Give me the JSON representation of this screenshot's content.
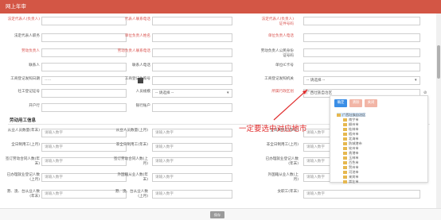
{
  "window": {
    "title": "网上年审"
  },
  "form_rows": [
    [
      {
        "label": "法定代表人(负责人)",
        "required": true,
        "value": "",
        "placeholder": ""
      },
      {
        "label": "代表人联系电话",
        "required": true,
        "value": "",
        "placeholder": ""
      },
      {
        "label": "法定代表人(负责人)证件号码",
        "required": true,
        "value": "",
        "placeholder": ""
      }
    ],
    [
      {
        "label": "法定代表人职务",
        "required": false,
        "value": "",
        "placeholder": ""
      },
      {
        "label": "单位负责人姓名",
        "required": true,
        "value": "",
        "placeholder": ""
      },
      {
        "label": "单位负责人电话",
        "required": true,
        "value": "",
        "placeholder": ""
      }
    ],
    [
      {
        "label": "劳动负责人",
        "required": true,
        "value": "",
        "placeholder": ""
      },
      {
        "label": "劳动负责人联系电话",
        "required": true,
        "value": "",
        "placeholder": ""
      },
      {
        "label": "劳动负责人公民身份证号码",
        "required": false,
        "value": "",
        "placeholder": ""
      }
    ],
    [
      {
        "label": "联系人",
        "required": false,
        "value": "",
        "placeholder": ""
      },
      {
        "label": "联系人电话",
        "required": false,
        "value": "",
        "placeholder": ""
      },
      {
        "label": "单位IC卡号",
        "required": false,
        "value": "",
        "placeholder": ""
      }
    ],
    [
      {
        "label": "工商登记发照日期",
        "required": false,
        "value": "-----",
        "placeholder": ""
      },
      {
        "label": "工商登记执照号",
        "required": false,
        "value": "",
        "placeholder": ""
      },
      {
        "label": "工商登记发照机关",
        "required": false,
        "value": "-- 请选择 --",
        "placeholder": ""
      }
    ],
    [
      {
        "label": "社工登记证号",
        "required": false,
        "value": "",
        "placeholder": ""
      },
      {
        "label": "人员规模",
        "required": false,
        "value": "-- 请选择 --",
        "placeholder": ""
      },
      {
        "label": "所属行政区划",
        "required": true,
        "value": "广西壮族自治区",
        "placeholder": ""
      }
    ],
    [
      {
        "label": "开户行",
        "required": false,
        "value": "",
        "placeholder": ""
      },
      {
        "label": "银行账户",
        "required": false,
        "value": "",
        "placeholder": ""
      },
      {
        "label": "",
        "required": false,
        "value": "",
        "placeholder": ""
      }
    ]
  ],
  "section": {
    "title": "劳动用工信息"
  },
  "labor_rows": [
    [
      {
        "label": "从业人员数量(年末)",
        "placeholder": "请输入数字"
      },
      {
        "label": "从业人员数量(上月)",
        "placeholder": "请输入数字"
      },
      {
        "label": "全日制用工(年末)",
        "placeholder": "请输入数字"
      }
    ],
    [
      {
        "label": "全日制用工(上月)",
        "placeholder": "请输入数字"
      },
      {
        "label": "非全日制用工(年末)",
        "placeholder": "请输入数字"
      },
      {
        "label": "非全日制用工(上月)",
        "placeholder": "请输入数字"
      }
    ],
    [
      {
        "label": "签订劳动合同人数(年末)",
        "placeholder": "请输入数字"
      },
      {
        "label": "签订劳动合同人数(上月)",
        "placeholder": "请输入数字"
      },
      {
        "label": "已办理就业登记人数(年末)",
        "placeholder": "请输入数字"
      }
    ],
    [
      {
        "label": "已办理就业登记人数(上月)",
        "placeholder": "请输入数字"
      },
      {
        "label": "外国籍从业人数(年末)",
        "placeholder": "请输入数字"
      },
      {
        "label": "外国籍从业人数(上月)",
        "placeholder": "请输入数字"
      }
    ],
    [
      {
        "label": "港、澳、台从业人数(年末)",
        "placeholder": "请输入数字"
      },
      {
        "label": "港、澳、台从业人数(上月)",
        "placeholder": "请输入数字"
      },
      {
        "label": "女职工(年末)",
        "placeholder": "请输入数字"
      }
    ]
  ],
  "region_panel": {
    "buttons": [
      "确定",
      "清除",
      "关闭"
    ],
    "root": "广西壮族自治区",
    "cities": [
      "南宁市",
      "柳州市",
      "桂林市",
      "梧州市",
      "北海市",
      "防城港市",
      "钦州市",
      "贵港市",
      "玉林市",
      "百色市",
      "贺州市",
      "河池市",
      "来宾市",
      "崇左市"
    ]
  },
  "annotation": {
    "text": "一定要选中对应地市"
  },
  "footer": {
    "save_label": "保存"
  },
  "colors": {
    "title_bar": "#d35645",
    "required_label": "#d9534f",
    "annotation": "#e03030"
  }
}
